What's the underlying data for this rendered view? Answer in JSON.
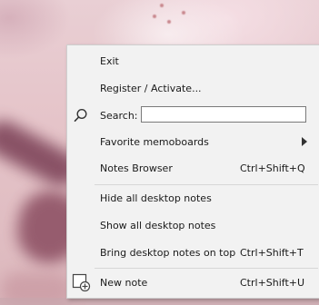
{
  "menu": {
    "items": {
      "exit": "Exit",
      "register": "Register / Activate...",
      "search_label": "Search:",
      "search_value": "",
      "favorite_memoboards": "Favorite memoboards",
      "notes_browser": "Notes Browser",
      "notes_browser_shortcut": "Ctrl+Shift+Q",
      "hide_all": "Hide all desktop notes",
      "show_all": "Show all desktop notes",
      "bring_on_top": "Bring desktop notes on top",
      "bring_on_top_shortcut": "Ctrl+Shift+T",
      "new_note": "New note",
      "new_note_shortcut": "Ctrl+Shift+U"
    }
  },
  "icons": {
    "search": "search-icon",
    "submenu": "chevron-right-icon",
    "new_note": "new-note-icon"
  },
  "colors": {
    "menu_background": "#f2f2f2",
    "separator": "#d7d7d7",
    "text": "#1a1a1a"
  }
}
